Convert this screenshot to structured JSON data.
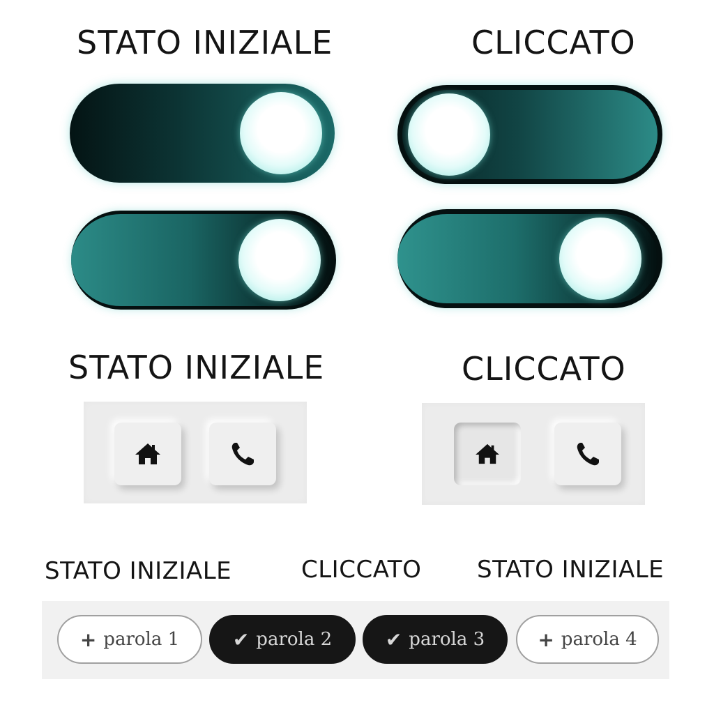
{
  "labels": {
    "top_left": "STATO INIZIALE",
    "top_right": "CLICCATO",
    "mid_left": "STATO INIZIALE",
    "mid_right": "CLICCATO",
    "bottom_1": "STATO INIZIALE",
    "bottom_2": "CLICCATO",
    "bottom_3": "STATO INIZIALE"
  },
  "toggles": [
    {
      "state": "initial",
      "knob": "right"
    },
    {
      "state": "clicked",
      "knob": "left"
    },
    {
      "state": "initial",
      "knob": "right"
    },
    {
      "state": "clicked",
      "knob": "right"
    }
  ],
  "icon_buttons": {
    "initial": [
      {
        "icon": "home-icon",
        "pressed": false
      },
      {
        "icon": "phone-icon",
        "pressed": false
      }
    ],
    "clicked": [
      {
        "icon": "home-icon",
        "pressed": true
      },
      {
        "icon": "phone-icon",
        "pressed": false
      }
    ]
  },
  "chips": [
    {
      "label": "parola 1",
      "symbol": "+",
      "selected": false
    },
    {
      "label": "parola 2",
      "symbol": "✔",
      "selected": true
    },
    {
      "label": "parola 3",
      "symbol": "✔",
      "selected": true
    },
    {
      "label": "parola 4",
      "symbol": "+",
      "selected": false
    }
  ],
  "colors": {
    "teal": "#2c8b87",
    "dark_teal": "#041414",
    "knob_glow": "#7fd9d1",
    "chip_selected": "#161616",
    "panel": "#ececec"
  }
}
